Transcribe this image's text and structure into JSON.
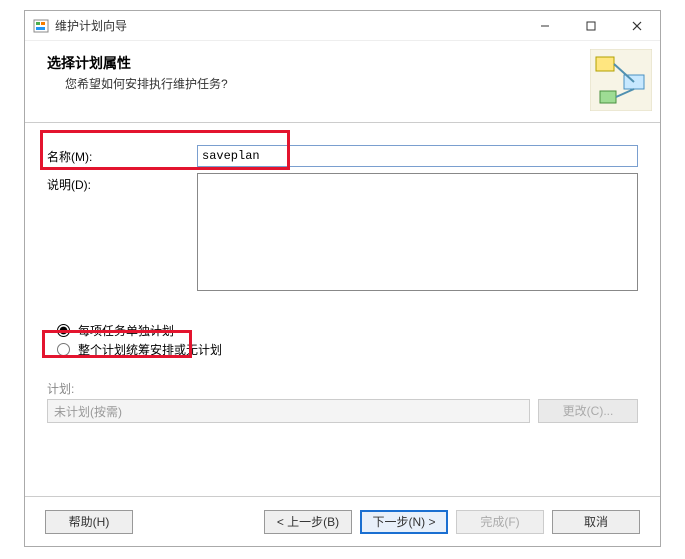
{
  "window": {
    "title": "维护计划向导"
  },
  "header": {
    "title": "选择计划属性",
    "subtitle": "您希望如何安排执行维护任务?"
  },
  "form": {
    "name_label": "名称(M):",
    "name_value": "saveplan",
    "desc_label": "说明(D):",
    "desc_value": ""
  },
  "radios": {
    "opt1": "每项任务单独计划",
    "opt2": "整个计划统筹安排或无计划"
  },
  "plan": {
    "section_label": "计划:",
    "value": "未计划(按需)",
    "change_label": "更改(C)..."
  },
  "footer": {
    "help": "帮助(H)",
    "back": "< 上一步(B)",
    "next": "下一步(N) >",
    "finish": "完成(F)",
    "cancel": "取消"
  }
}
